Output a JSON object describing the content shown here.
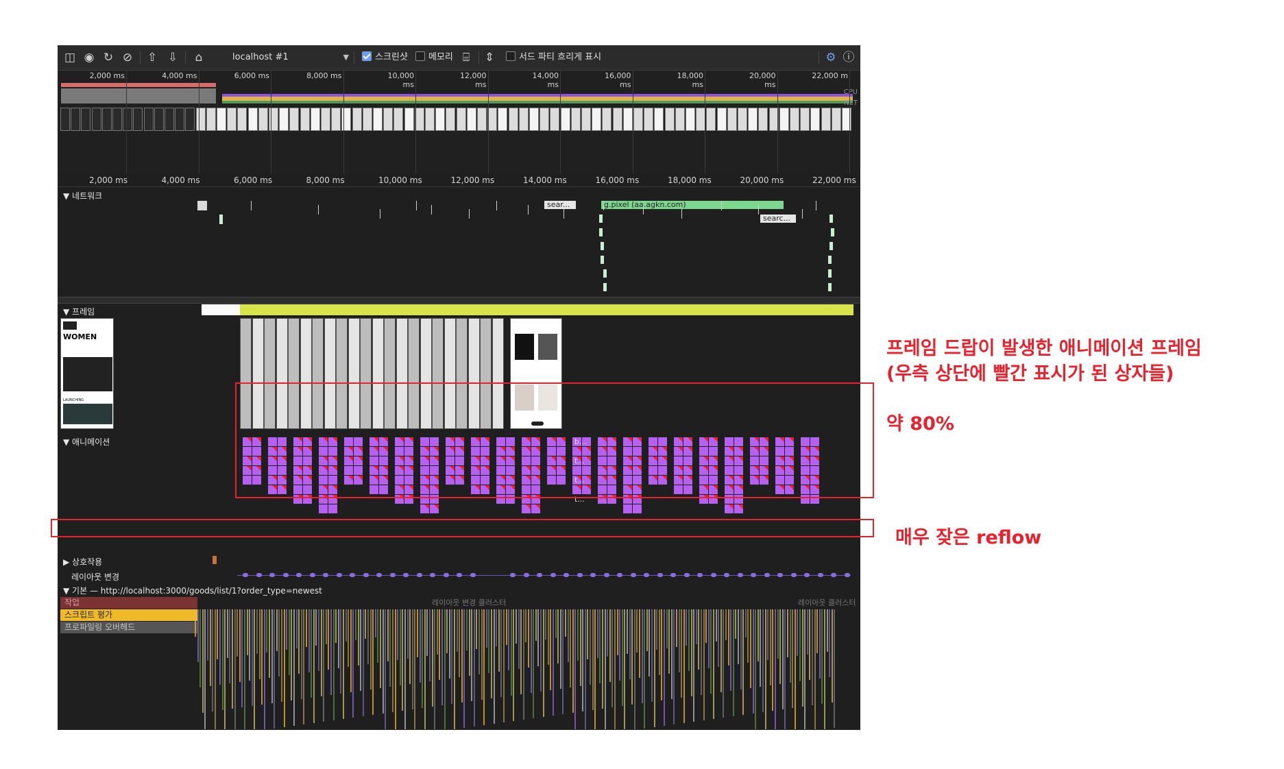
{
  "toolbar": {
    "icons": [
      "sidebar-toggle-icon",
      "record-icon",
      "reload-icon",
      "clear-icon",
      "upload-icon",
      "download-icon",
      "home-icon"
    ],
    "profile_select": "localhost #1",
    "screenshot_label": "스크린샷",
    "screenshot_checked": true,
    "memory_label": "메모리",
    "memory_checked": false,
    "third_party_label": "서드 파티 흐리게 표시",
    "third_party_checked": false,
    "right_icons": [
      "settings-icon",
      "help-icon"
    ]
  },
  "overview": {
    "ticks": [
      "2,000 ms",
      "4,000 ms",
      "6,000 ms",
      "8,000 ms",
      "10,000 ms",
      "12,000 ms",
      "14,000 ms",
      "16,000 ms",
      "18,000 ms",
      "20,000 ms",
      "22,000 m"
    ],
    "cpu_label": "CPU",
    "net_label": "NET"
  },
  "ruler": {
    "ticks": [
      "2,000 ms",
      "4,000 ms",
      "6,000 ms",
      "8,000 ms",
      "10,000 ms",
      "12,000 ms",
      "14,000 ms",
      "16,000 ms",
      "18,000 ms",
      "20,000 ms",
      "22,000 ms"
    ]
  },
  "tracks": {
    "network": "▼ 네트워크",
    "frames": "▼ 프레임",
    "animations": "▼ 애니메이션",
    "interactions": "▶ 상호작용",
    "layout_shifts": "레이아웃 변경",
    "main": "▼ 기본 — http://localhost:3000/goods/list/1?order_type=newest"
  },
  "network_requests": {
    "r1": "sear...",
    "r2": "g.pixel (aa.agkn.com)",
    "r3": "searc..."
  },
  "frame_thumb": {
    "heading": "WOMEN",
    "subheading": "LAUNCHING"
  },
  "animation_labels": [
    "b...",
    "t...",
    "t...",
    "t..."
  ],
  "main_rows": {
    "task": "작업",
    "script": "스크립트 평가",
    "overhead": "프로파일링 오버헤드",
    "ghost1": "레이아웃 변경 클러스터",
    "ghost2": "레이아웃 클러스터"
  },
  "colors": {
    "animation": "#b660f1",
    "drop": "#e8213a",
    "annotation": "#e8212c",
    "script": "#f0b928",
    "frames": "#d9e44a"
  },
  "annotations": {
    "frames_title": "프레임 드랍이 발생한 애니메이션 프레임",
    "frames_sub": "(우측 상단에 빨간 표시가 된 상자들)",
    "percent": "약 80%",
    "reflow": "매우 잦은 reflow"
  }
}
